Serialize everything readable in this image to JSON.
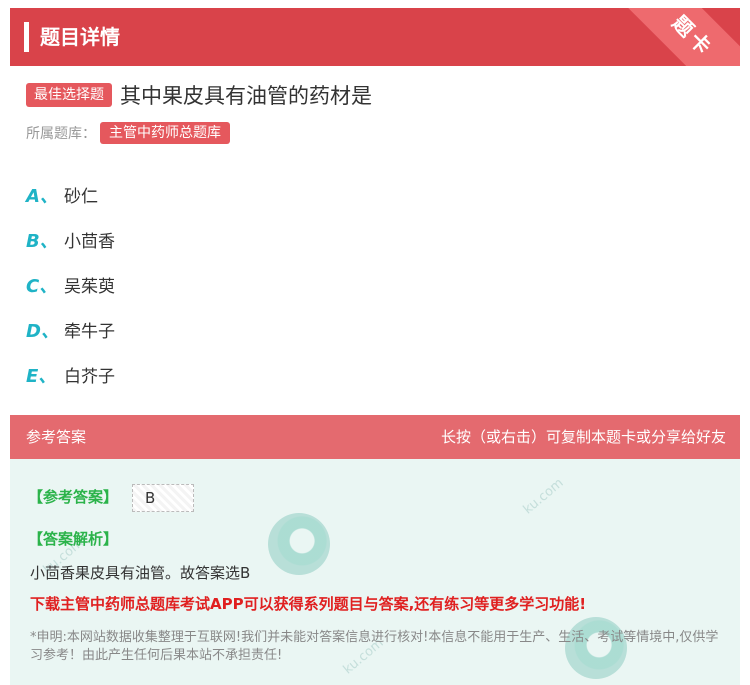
{
  "header": {
    "title": "题目详情",
    "corner": "题卡"
  },
  "question": {
    "type_badge": "最佳选择题",
    "text": "其中果皮具有油管的药材是",
    "bank_label": "所属题库：",
    "bank_name": "主管中药师总题库"
  },
  "options": [
    {
      "letter": "A、",
      "text": "砂仁"
    },
    {
      "letter": "B、",
      "text": "小茴香"
    },
    {
      "letter": "C、",
      "text": "吴茱萸"
    },
    {
      "letter": "D、",
      "text": "牵牛子"
    },
    {
      "letter": "E、",
      "text": "白芥子"
    }
  ],
  "answer_section": {
    "title": "参考答案",
    "hint": "长按（或右击）可复制本题卡或分享给好友",
    "answer_label": "【参考答案】",
    "answer_value": "B",
    "explanation_label": "【答案解析】",
    "explanation": "小茴香果皮具有油管。故答案选B",
    "promo": "下载主管中药师总题库考试APP可以获得系列题目与答案,还有练习等更多学习功能!",
    "disclaimer": "*申明:本网站数据收集整理于互联网!我们并未能对答案信息进行核对!本信息不能用于生产、生活、考试等情境中,仅供学习参考！由此产生任何后果本站不承担责任!"
  },
  "colors": {
    "brand_red": "#d9434a",
    "option_letter": "#1fb3c6",
    "answer_green": "#2bb34a",
    "promo_red": "#e02020"
  }
}
